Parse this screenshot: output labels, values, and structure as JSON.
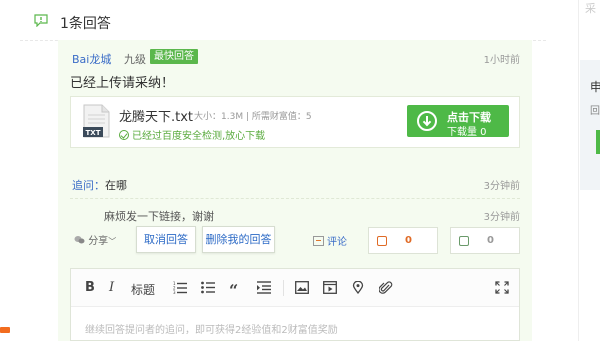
{
  "header": {
    "answer_count": "1条回答"
  },
  "answer": {
    "author": "Bai龙城",
    "level": "九级",
    "best_badge": "最快回答",
    "time": "1小时前",
    "text": "已经上传请采纳！",
    "file": {
      "icon_type": "TXT",
      "name": "龙腾天下.txt",
      "meta": "大小：1.3M | 所需财富值：5",
      "safety": "已经过百度安全检测,放心下载",
      "download_label": "点击下载",
      "download_count": "下载量 0"
    }
  },
  "followup": {
    "label": "追问：",
    "question": "在哪",
    "question_time": "3分钟前",
    "reply": "麻烦发一下链接，谢谢",
    "reply_time": "3分钟前"
  },
  "actions": {
    "share": "分享",
    "cancel_answer": "取消回答",
    "delete_answer": "删除我的回答",
    "comment": "评论",
    "upvotes": "0",
    "downvotes": "0"
  },
  "editor": {
    "bold": "B",
    "italic": "I",
    "heading": "标题",
    "placeholder": "继续回答提问者的追问，即可获得2经验值和2财富值奖励"
  },
  "right_panel": {
    "top_text": "采",
    "char1": "申",
    "char2": "回"
  },
  "colors": {
    "accent_green": "#4eb947",
    "link_blue": "#3a6cc7",
    "bg_green": "#f5fbf0"
  }
}
